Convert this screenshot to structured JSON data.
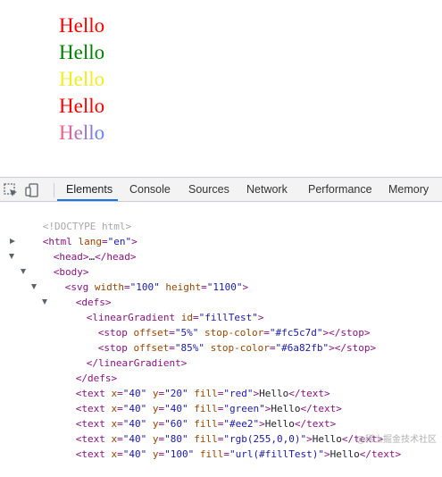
{
  "page": {
    "hello_lines": [
      {
        "text": "Hello",
        "fill": "#ff0000"
      },
      {
        "text": "Hello",
        "fill": "#008000"
      },
      {
        "text": "Hello",
        "fill": "#eeee22"
      },
      {
        "text": "Hello",
        "fill": "#ff0000"
      },
      {
        "text": "Hello",
        "fill": "url(#fillTest)"
      }
    ],
    "gradient": {
      "id": "fillTest",
      "stops": [
        {
          "offset": "5%",
          "color": "#fc5c7d"
        },
        {
          "offset": "85%",
          "color": "#6a82fb"
        }
      ]
    }
  },
  "devtools": {
    "icons": [
      "inspect-element-icon",
      "device-toolbar-icon"
    ],
    "tabs": [
      "Elements",
      "Console",
      "Sources",
      "Network",
      "Performance",
      "Memory"
    ],
    "active_tab": "Elements",
    "accent": "#1a73e8",
    "dom": {
      "doctype": "<!DOCTYPE html>",
      "html_open": "<html lang=\"en\">",
      "head": "<head>…</head>",
      "body_open": "<body>",
      "svg_open": "<svg width=\"100\" height=\"1100\">",
      "defs_open": "<defs>",
      "gradient_open": "<linearGradient id=\"fillTest\">",
      "stop1": "<stop offset=\"5%\" stop-color=\"#fc5c7d\"></stop>",
      "stop2": "<stop offset=\"85%\" stop-color=\"#6a82fb\"></stop>",
      "gradient_close": "</linearGradient>",
      "defs_close": "</defs>",
      "text1": "<text x=\"40\" y=\"20\" fill=\"red\">Hello</text>",
      "text2": "<text x=\"40\" y=\"40\" fill=\"green\">Hello</text>",
      "text3": "<text x=\"40\" y=\"60\" fill=\"#ee2\">Hello</text>",
      "text4": "<text x=\"40\" y=\"80\" fill=\"rgb(255,0,0)\">Hello</text>",
      "text5": "<text x=\"40\" y=\"100\" fill=\"url(#fillTest)\">Hello</text>"
    }
  },
  "watermark": "@稀土掘金技术社区"
}
